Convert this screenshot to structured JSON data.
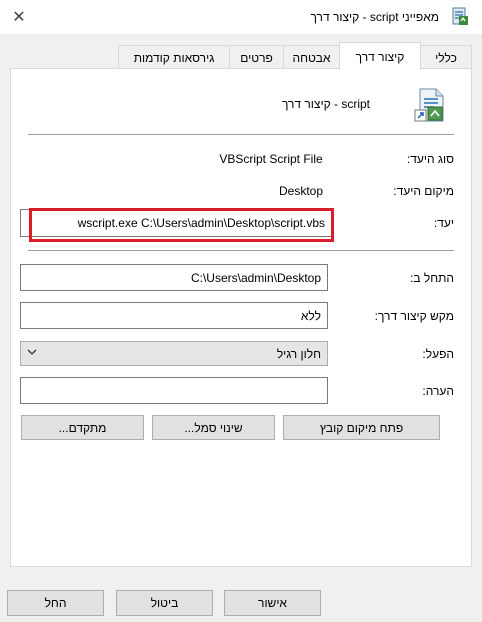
{
  "window": {
    "title": "מאפייני script - קיצור דרך",
    "close_glyph": "✕"
  },
  "tabs": [
    {
      "label": "כללי"
    },
    {
      "label": "קיצור דרך"
    },
    {
      "label": "אבטחה"
    },
    {
      "label": "פרטים"
    },
    {
      "label": "גירסאות קודמות"
    }
  ],
  "shortcut": {
    "name": "script - קיצור דרך",
    "icon": "vbscript-shortcut-icon",
    "target_type_label": "סוג היעד:",
    "target_type_value": "VBScript Script File",
    "target_location_label": "מיקום היעד:",
    "target_location_value": "Desktop",
    "target_label": "יעד:",
    "target_value": "wscript.exe C:\\Users\\admin\\Desktop\\script.vbs",
    "start_in_label": "התחל ב:",
    "start_in_value": "C:\\Users\\admin\\Desktop",
    "shortcut_key_label": "מקש קיצור דרך:",
    "shortcut_key_value": "ללא",
    "run_label": "הפעל:",
    "run_value": "חלון רגיל",
    "comment_label": "הערה:",
    "comment_value": ""
  },
  "buttons": {
    "open_location": "פתח מיקום קובץ",
    "change_icon": "שינוי סמל...",
    "advanced": "מתקדם...",
    "ok": "אישור",
    "cancel": "ביטול",
    "apply": "החל"
  },
  "colors": {
    "highlight": "#d81e2a"
  }
}
